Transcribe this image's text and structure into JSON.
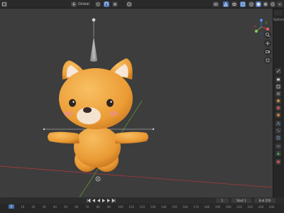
{
  "header": {
    "view_menu": "View",
    "orientation_label": "Global",
    "colors": {
      "active": "#4772b3",
      "bg": "#2a2a2a"
    }
  },
  "viewport": {
    "object": "bear-character-model",
    "colors": {
      "body": "#f0a53c",
      "ear_inner": "#f6e7d8",
      "muzzle": "#f3e3cf",
      "nose": "#3a2b2a",
      "blush": "#ef8f88",
      "bone": "#a0a0a0",
      "x_axis": "#9a3b3b",
      "y_axis": "#5c8a3a"
    }
  },
  "gizmo": {
    "x_label": "X",
    "y_label": "Y",
    "z_label": "Z"
  },
  "properties": {
    "header_label": "Options"
  },
  "timeline": {
    "start_label": "Start",
    "start_value": "1",
    "end_label": "End",
    "end_value": "250",
    "current_frame": "1",
    "ticks": [
      "0",
      "10",
      "20",
      "30",
      "40",
      "50",
      "60",
      "70",
      "80",
      "90",
      "100",
      "110",
      "120",
      "130",
      "140",
      "150",
      "160",
      "170",
      "180",
      "190",
      "200",
      "210",
      "220",
      "230",
      "240",
      "250"
    ]
  }
}
